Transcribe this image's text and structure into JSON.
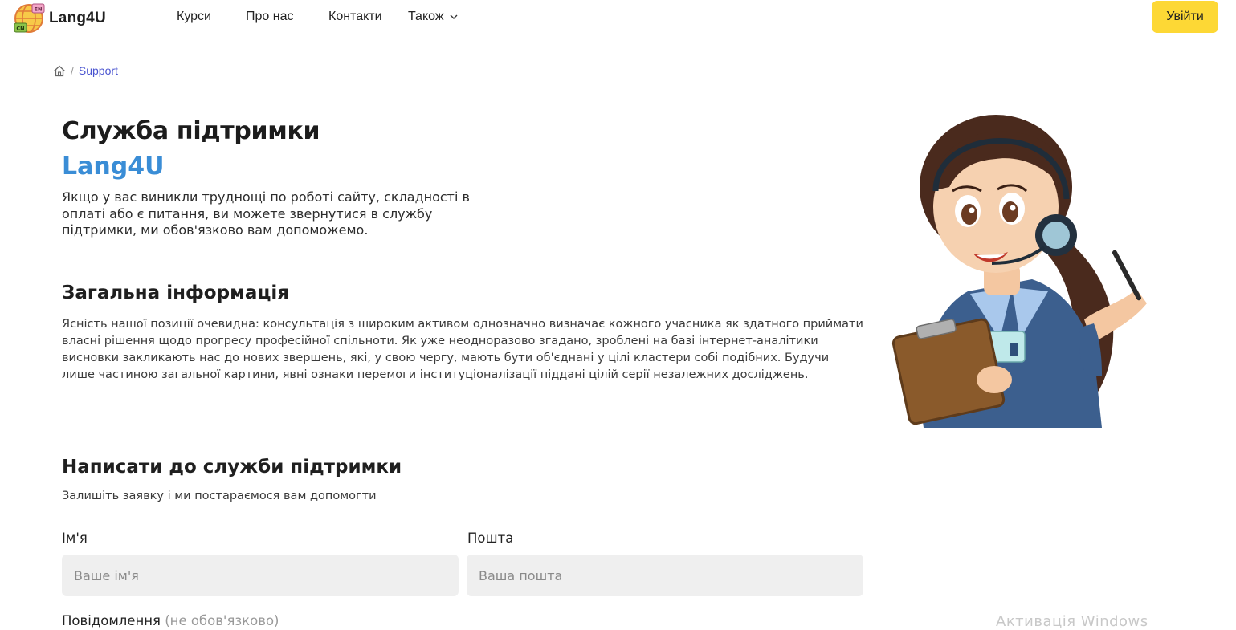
{
  "header": {
    "logo_text": "Lang4U",
    "logo_badge_top": "EN",
    "logo_badge_bottom": "CN",
    "nav": [
      {
        "label": "Курси"
      },
      {
        "label": "Про нас"
      },
      {
        "label": "Контакти"
      },
      {
        "label": "Також"
      }
    ],
    "login_label": "Увійти"
  },
  "breadcrumb": {
    "current": "Support",
    "separator": "/"
  },
  "hero": {
    "title": "Служба підтримки",
    "brand": "Lang4U",
    "intro": "Якщо у вас виникли труднощі по роботі сайту, складності в оплаті або є питання, ви можете звернутися в службу підтримки, ми обов'язково вам допоможемо."
  },
  "general": {
    "heading": "Загальна інформація",
    "text": "Ясність нашої позиції очевидна: консультація з широким активом однозначно визначає кожного учасника як здатного приймати власні рішення щодо прогресу професійної спільноти. Як уже неодноразово згадано, зроблені на базі інтернет-аналітики висновки закликають нас до нових звершень, які, у свою чергу, мають бути об'єднані у цілі кластери собі подібних. Будучи лише частиною загальної картини, явні ознаки перемоги інституціоналізації піддані цілій серії незалежних досліджень."
  },
  "form": {
    "heading": "Написати до служби підтримки",
    "subtitle": "Залишіть заявку і ми постараємося вам допомогти",
    "name_label": "Ім'я",
    "name_placeholder": "Ваше ім'я",
    "email_label": "Пошта",
    "email_placeholder": "Ваша пошта",
    "message_label": "Повідомлення",
    "message_optional": "(не обов'язково)"
  },
  "watermark": "Активація Windows",
  "colors": {
    "accent_yellow": "#fdd835",
    "brand_blue": "#3a8dd6",
    "link": "#4a54d0",
    "input_bg": "#efefef"
  }
}
